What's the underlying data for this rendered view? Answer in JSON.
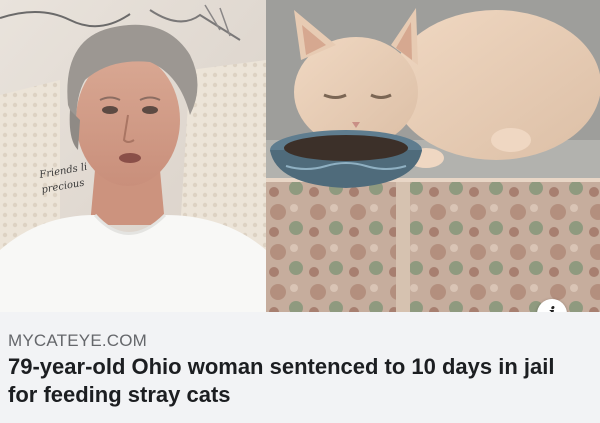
{
  "photos": {
    "left_sign_text": [
      "Friends li",
      "precious"
    ]
  },
  "info_button": {
    "icon": "info-icon",
    "glyph": "i"
  },
  "link_preview": {
    "source": "MYCATEYE.COM",
    "headline": "79-year-old Ohio woman sentenced to 10 days in jail for feeding stray cats"
  }
}
